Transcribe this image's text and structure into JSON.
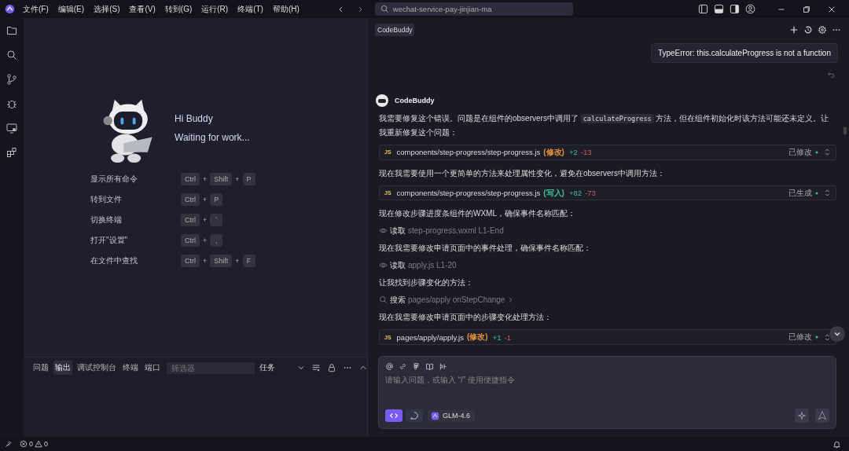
{
  "menu": [
    "文件(F)",
    "编辑(E)",
    "选择(S)",
    "查看(V)",
    "转到(G)",
    "运行(R)",
    "终端(T)",
    "帮助(H)"
  ],
  "search": {
    "value": "wechat-service-pay-jinjian-ma"
  },
  "welcome": {
    "greeting": "Hi Buddy",
    "status": "Waiting for work...",
    "shortcuts": [
      {
        "label": "显示所有命令",
        "keys": [
          "Ctrl",
          "+",
          "Shift",
          "+",
          "P"
        ]
      },
      {
        "label": "转到文件",
        "keys": [
          "Ctrl",
          "+",
          "P"
        ]
      },
      {
        "label": "切换终端",
        "keys": [
          "Ctrl",
          "+",
          "`"
        ]
      },
      {
        "label": "打开\"设置\"",
        "keys": [
          "Ctrl",
          "+",
          ","
        ]
      },
      {
        "label": "在文件中查找",
        "keys": [
          "Ctrl",
          "+",
          "Shift",
          "+",
          "F"
        ]
      }
    ]
  },
  "panel": {
    "tabs": [
      {
        "label": "问题",
        "selected": false
      },
      {
        "label": "输出",
        "selected": true
      },
      {
        "label": "调试控制台",
        "selected": false
      },
      {
        "label": "终端",
        "selected": false
      },
      {
        "label": "端口",
        "selected": false
      }
    ],
    "filter": {
      "placeholder": "筛选器"
    },
    "dropdown": "任务"
  },
  "chat": {
    "tab": "CodeBuddy",
    "user_message": "TypeError: this.calculateProgress is not a function",
    "assistant": "CodeBuddy",
    "messages": [
      {
        "kind": "text",
        "parts": [
          {
            "text": "我需要修复这个错误。问题是在组件的observers中调用了 ",
            "code": false
          },
          {
            "text": "calculateProgress",
            "code": true
          },
          {
            "text": " 方法，但在组件初始化时该方法可能还未定义。让我重新修复这个问题：",
            "code": false
          }
        ]
      },
      {
        "kind": "file",
        "badge": "JS",
        "name": "components/step-progress/step-progress.js",
        "action": "(修改)",
        "color": "#e0913a",
        "added": "+2",
        "removed": "-13",
        "status": "已修改"
      },
      {
        "kind": "text",
        "parts": [
          {
            "text": "现在我需要使用一个更简单的方法来处理属性变化，避免在observers中调用方法：",
            "code": false
          }
        ]
      },
      {
        "kind": "file",
        "badge": "JS",
        "name": "components/step-progress/step-progress.js",
        "action": "(写入)",
        "color": "#3fbf8f",
        "added": "+82",
        "removed": "-73",
        "status": "已生成"
      },
      {
        "kind": "text",
        "parts": [
          {
            "text": "现在修改步骤进度条组件的WXML，确保事件名称匹配：",
            "code": false
          }
        ]
      },
      {
        "kind": "read",
        "verb": "读取",
        "target": "step-progress.wxml L1-End",
        "expandable": false
      },
      {
        "kind": "text",
        "parts": [
          {
            "text": "现在我需要修改申请页面中的事件处理，确保事件名称匹配：",
            "code": false
          }
        ]
      },
      {
        "kind": "read",
        "verb": "读取",
        "target": "apply.js L1-20",
        "expandable": false
      },
      {
        "kind": "text",
        "parts": [
          {
            "text": "让我找到步骤变化的方法：",
            "code": false
          }
        ]
      },
      {
        "kind": "search",
        "verb": "搜索",
        "target": "pages/apply onStepChange",
        "expandable": true
      },
      {
        "kind": "text",
        "parts": [
          {
            "text": "现在我需要修改申请页面中的步骤变化处理方法：",
            "code": false
          }
        ]
      },
      {
        "kind": "file",
        "badge": "JS",
        "name": "pages/apply/apply.js",
        "action": "(修改)",
        "color": "#e0913a",
        "added": "+1",
        "removed": "-1",
        "status": "已修改"
      }
    ],
    "input": {
      "placeholder": "请输入问题，或输入 “/” 使用便捷指令"
    },
    "modes": [
      {
        "kind": "code",
        "selected": true
      },
      {
        "kind": "chat",
        "selected": false
      }
    ],
    "model": "GLM-4.6"
  },
  "status_bar": {
    "errors": "0",
    "warnings": "0"
  }
}
